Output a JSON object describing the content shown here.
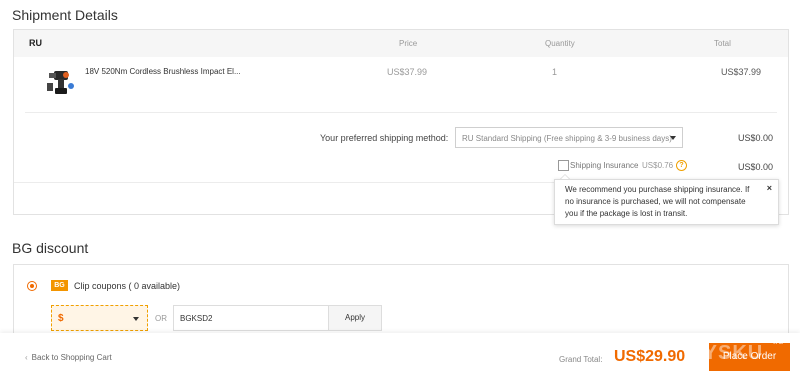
{
  "shipment": {
    "title": "Shipment Details",
    "country": "RU",
    "headers": {
      "price": "Price",
      "quantity": "Quantity",
      "total": "Total"
    },
    "product": {
      "name": "18V 520Nm Cordless Brushless Impact El...",
      "price": "US$37.99",
      "quantity": "1",
      "total": "US$37.99"
    },
    "method_label": "Your preferred shipping method:",
    "method_value": "RU Standard Shipping (Free shipping & 3-9 business days)",
    "method_cost": "US$0.00",
    "insurance_label": "Shipping Insurance",
    "insurance_price": "US$0.76",
    "insurance_help": "?",
    "insurance_cost": "US$0.00",
    "tooltip_text": "We recommend you purchase shipping insurance. If no insurance is purchased, we will not compensate you if the package is lost in transit.",
    "tooltip_close": "×"
  },
  "discount": {
    "title": "BG discount",
    "coupon_icon": "BG",
    "clip_label": "Clip coupons ( 0 available)",
    "dollar_value": "$",
    "or_label": "OR",
    "code_value": "BGKSD2",
    "apply_label": "Apply"
  },
  "footer": {
    "back_label": "Back to Shopping Cart",
    "back_icon": "‹",
    "grand_label": "Grand Total:",
    "grand_value": "US$29.90",
    "order_label": "Place Order",
    "watermark": "MYSKU",
    "watermark_ru": ".ru"
  },
  "colors": {
    "accent": "#f06a00",
    "coupon": "#f39500",
    "warning": "#f0a000"
  }
}
